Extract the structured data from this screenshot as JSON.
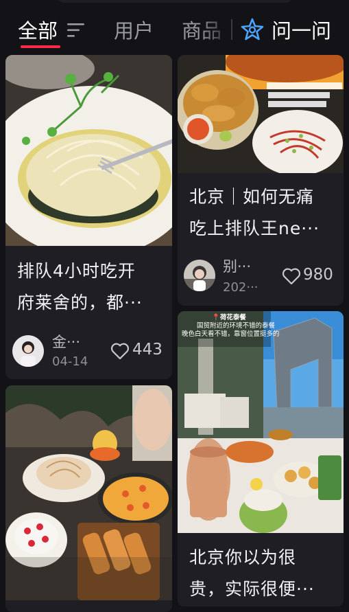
{
  "tabs": [
    {
      "label": "全部",
      "active": true
    },
    {
      "label": "用户",
      "active": false
    },
    {
      "label": "商品",
      "active": false
    }
  ],
  "ask_tab": {
    "label": "问一问",
    "icon": "sparkle-star-icon"
  },
  "colors": {
    "accent": "#ff2a45",
    "ask_icon": "#4aa6ff",
    "background": "#121217",
    "card": "#1e1e24"
  },
  "cards": [
    {
      "title_line1": "排队4小时吃开",
      "title_line2": "府莱舍的，都···",
      "author": "金···",
      "date": "04-14",
      "likes": "443"
    },
    {
      "title_line1": "北京｜如何无痛",
      "title_line2": "吃上排队王ne···",
      "author": "别···",
      "date": "202···",
      "likes": "980"
    },
    {
      "title_line1": "北京你以为很",
      "title_line2": "贵，实际很便···",
      "image_caption_title": "荷花泰餐",
      "image_caption_lines": [
        "国贸附近的环境不错的泰餐",
        "晚色白天看不错，靠窗位置挺多的"
      ]
    },
    {
      "title_line1": ""
    }
  ]
}
